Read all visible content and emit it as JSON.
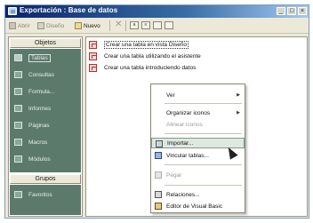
{
  "window": {
    "title": "Exportación : Base de datos",
    "min_glyph": "_",
    "max_glyph": "□",
    "close_glyph": "×"
  },
  "toolbar": {
    "open_label": "Abrir",
    "design_label": "Diseño",
    "new_label": "Nuevo",
    "small_icon_1": "a",
    "small_icon_2": "≡"
  },
  "sidebar": {
    "objects_header": "Objetos",
    "items": [
      {
        "label": "Tablas",
        "icon": "table-icon",
        "selected": true
      },
      {
        "label": "Consultas",
        "icon": "query-icon"
      },
      {
        "label": "Formula...",
        "icon": "form-icon"
      },
      {
        "label": "Informes",
        "icon": "report-icon"
      },
      {
        "label": "Páginas",
        "icon": "page-icon"
      },
      {
        "label": "Macros",
        "icon": "macro-icon"
      },
      {
        "label": "Módulos",
        "icon": "module-icon"
      }
    ],
    "groups_header": "Grupos",
    "favorites": {
      "label": "Favoritos",
      "icon": "favorites-icon"
    }
  },
  "content": {
    "rows": [
      "Crear una tabla en vista Diseño",
      "Crear una tabla utilizando el asistente",
      "Crear una tabla introduciendo datos"
    ]
  },
  "context_menu": {
    "items": [
      {
        "label": "Ver",
        "submenu": true
      },
      {
        "label": "Organizar iconos",
        "submenu": true
      },
      {
        "label": "Alinear iconos",
        "disabled": true
      },
      {
        "label": "Importar...",
        "highlighted": true,
        "icon": "import-icon"
      },
      {
        "label": "Vincular tablas...",
        "icon": "link-tables-icon"
      },
      {
        "label": "Pegar",
        "disabled": true,
        "icon": "paste-icon"
      },
      {
        "label": "Relaciones...",
        "icon": "relationships-icon"
      },
      {
        "label": "Editor de Visual Basic",
        "icon": "vba-editor-icon"
      }
    ],
    "submenu_glyph": "▶"
  },
  "colors": {
    "sidebar_bg": "#5c7a6c",
    "title_bar": "#0a246a",
    "highlight": "#dfe8e0"
  }
}
